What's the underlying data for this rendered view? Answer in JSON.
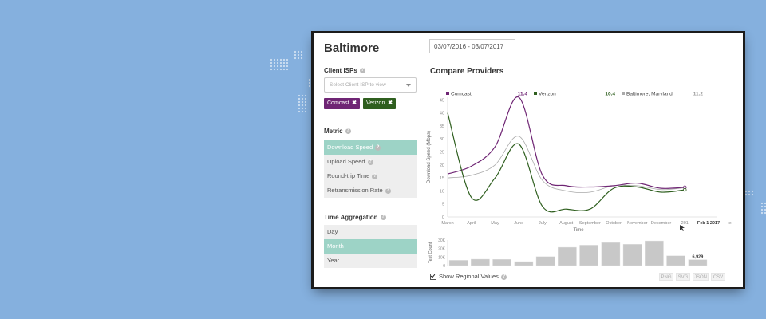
{
  "city": "Baltimore",
  "date_range": "03/07/2016 - 03/07/2017",
  "isp_section": {
    "label": "Client ISPs",
    "placeholder": "Select Client ISP to view"
  },
  "tags": [
    {
      "label": "Comcast",
      "color": "#6f2574"
    },
    {
      "label": "Verizon",
      "color": "#2f5f1f"
    }
  ],
  "metric_section": {
    "label": "Metric",
    "items": [
      {
        "label": "Download Speed",
        "active": true
      },
      {
        "label": "Upload Speed",
        "active": false
      },
      {
        "label": "Round-trip Time",
        "active": false
      },
      {
        "label": "Retransmission Rate",
        "active": false
      }
    ]
  },
  "time_section": {
    "label": "Time Aggregation",
    "items": [
      {
        "label": "Day",
        "active": false
      },
      {
        "label": "Month",
        "active": true
      },
      {
        "label": "Year",
        "active": false
      }
    ]
  },
  "compare_title": "Compare Providers",
  "show_regional": "Show Regional Values",
  "export_buttons": [
    "PNG",
    "SVG",
    "JSON",
    "CSV"
  ],
  "colors": {
    "comcast": "#6f2574",
    "verizon": "#2f5f1f",
    "regional": "#aaaaaa",
    "accent": "#9dd3c6",
    "background": "#85b0de"
  },
  "chart_data": [
    {
      "type": "line",
      "ylabel": "Download Speed (Mbps)",
      "xlabel": "Time",
      "ylim": [
        0,
        46
      ],
      "y_ticks": [
        0,
        5,
        10,
        15,
        20,
        25,
        30,
        35,
        40,
        45
      ],
      "x": [
        "March",
        "April",
        "May",
        "June",
        "July",
        "August",
        "September",
        "October",
        "November",
        "December",
        "201",
        "Feb 1 2017",
        "ech"
      ],
      "highlight_label": "Feb 1 2017",
      "series": [
        {
          "name": "Comcast",
          "value_label": "11.4",
          "color": "#6f2574",
          "values": [
            16.5,
            19.5,
            27,
            46,
            16,
            12,
            11.5,
            12,
            13,
            11,
            11.4
          ]
        },
        {
          "name": "Verizon",
          "value_label": "10.4",
          "color": "#2f5f1f",
          "values": [
            40,
            7.5,
            15,
            28,
            4,
            3,
            3,
            11,
            11.5,
            9.5,
            10.4
          ]
        },
        {
          "name": "Baltimore, Maryland",
          "value_label": "11.2",
          "color": "#aaaaaa",
          "values": [
            15,
            16,
            20,
            31,
            14,
            10,
            9.5,
            12,
            12,
            10.5,
            11.2
          ]
        }
      ]
    },
    {
      "type": "bar",
      "ylabel": "Test Count",
      "y_ticks": [
        "0",
        "10K",
        "20K",
        "30K"
      ],
      "ylim": [
        0,
        30000
      ],
      "values": [
        6200,
        7500,
        7300,
        4700,
        10500,
        21500,
        24000,
        27000,
        25000,
        29000,
        11500,
        6929
      ],
      "value_label": "6,929"
    }
  ]
}
